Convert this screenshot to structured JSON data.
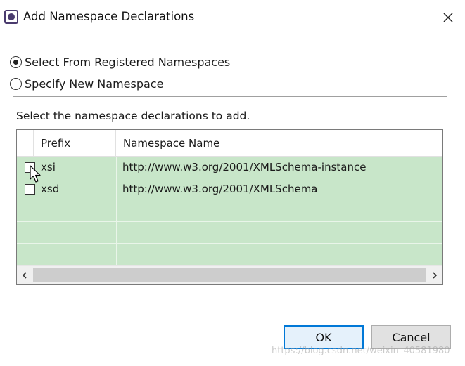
{
  "window": {
    "title": "Add Namespace Declarations"
  },
  "options": {
    "registered": "Select From Registered Namespaces",
    "specify": "Specify New Namespace",
    "selected": "registered"
  },
  "instruction": "Select the namespace declarations to add.",
  "table": {
    "columns": [
      "",
      "Prefix",
      "Namespace Name"
    ],
    "rows": [
      {
        "checked": false,
        "prefix": "xsi",
        "namespace": "http://www.w3.org/2001/XMLSchema-instance"
      },
      {
        "checked": false,
        "prefix": "xsd",
        "namespace": "http://www.w3.org/2001/XMLSchema"
      }
    ]
  },
  "buttons": {
    "ok": "OK",
    "cancel": "Cancel"
  },
  "watermark": "https://blog.csdn.net/weixin_40581980",
  "colors": {
    "row_background": "#c8e6c9",
    "ok_border": "#0078d7",
    "button_face": "#e1e1e1"
  }
}
